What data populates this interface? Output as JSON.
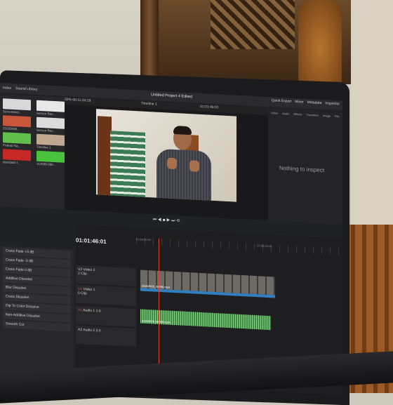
{
  "topbar": {
    "index": "Index",
    "sound_library": "Sound Library",
    "project": "Untitled Project 4",
    "edited": "Edited",
    "quick_export": "Quick Export",
    "mixer": "Mixer",
    "metadata": "Metadata",
    "inspector": "Inspector"
  },
  "viewer_head": {
    "zoom": "32%",
    "timecode_src": "00:11:34:29",
    "timeline_name": "Timeline 1",
    "timecode_rec": "01:01:46:01",
    "clip": "20250509_04..."
  },
  "media": [
    {
      "label": "Screenshot...",
      "color": "#d8d8d8"
    },
    {
      "label": "Screen Rec...",
      "color": "#e7e7e7"
    },
    {
      "label": "20250508...",
      "color": "#c9553b"
    },
    {
      "label": "Screen Rec...",
      "color": "#dcdcdc"
    },
    {
      "label": "Prahad Na...",
      "color": "#5fbf4a"
    },
    {
      "label": "Timeline 1",
      "color": "#c0a890"
    },
    {
      "label": "doordash l...",
      "color": "#c62828"
    },
    {
      "label": "112699-685...",
      "color": "#49c23c"
    }
  ],
  "inspector_tabs": [
    "Video",
    "Audio",
    "Effects",
    "Transition",
    "Image",
    "File"
  ],
  "inspector_empty": "Nothing to inspect",
  "effects": [
    "Cross Fade +3 dB",
    "Cross Fade -3 dB",
    "Cross Fade 0 dB",
    "Additive Dissolve",
    "Blur Dissolve",
    "Cross Dissolve",
    "Dip To Color Dissolve",
    "Non-Additive Dissolve",
    "Smooth Cut"
  ],
  "timeline": {
    "timecode": "01:01:46:01",
    "ruler_start": "01:00:00:00",
    "ruler_mid": "01:02:00:00",
    "tracks": [
      {
        "id": "V2",
        "name": "Video 2",
        "info": "2 Clip"
      },
      {
        "id": "V1",
        "name": "Video 1",
        "info": "0 Clip"
      },
      {
        "id": "A1",
        "name": "Audio 1",
        "info": "1.0"
      },
      {
        "id": "A2",
        "name": "Audio 2",
        "info": "2.0"
      }
    ],
    "video_clip": "20250509_04398.mp4",
    "audio_clip": "20250509_04398.mp4"
  },
  "colors": {
    "accent_blue": "#2f7fc1",
    "audio_green": "#3e8a4b",
    "playhead": "#e0452f"
  }
}
